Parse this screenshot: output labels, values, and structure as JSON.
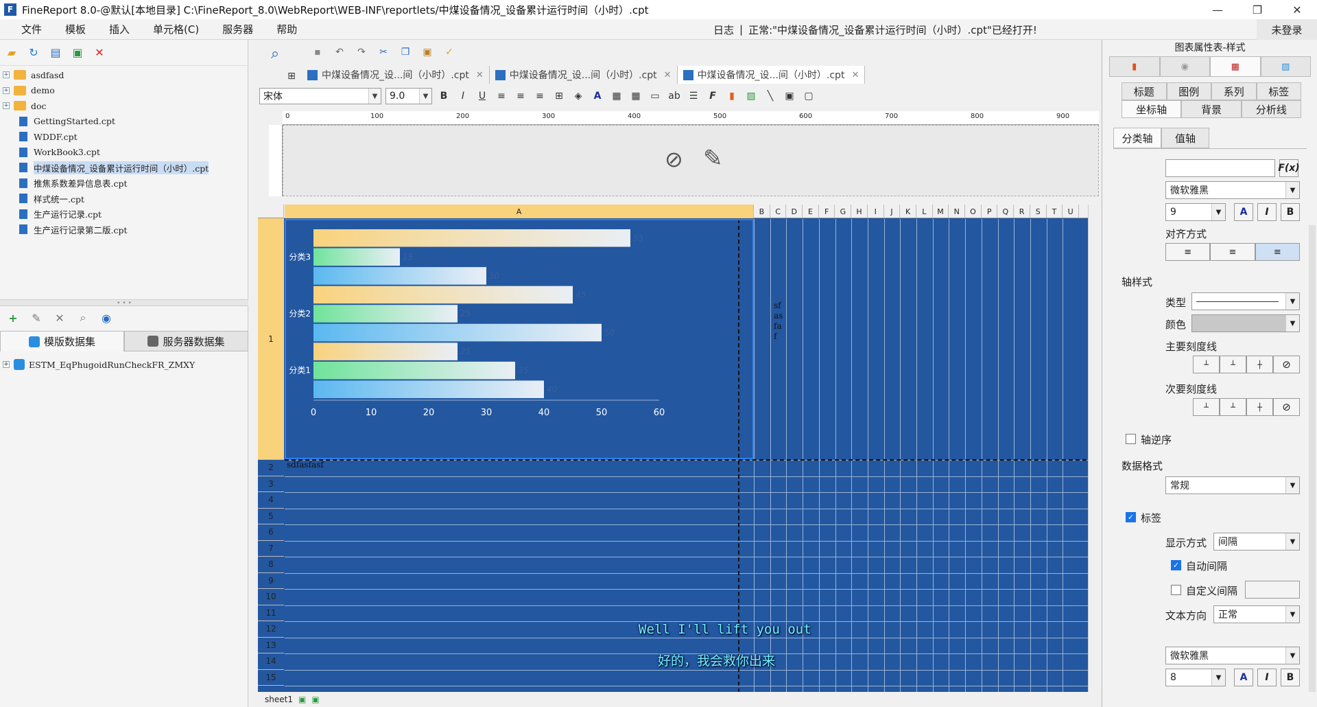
{
  "window": {
    "title": "FineReport 8.0-@默认[本地目录]   C:\\FineReport_8.0\\WebReport\\WEB-INF\\reportlets/中煤设备情况_设备累计运行时间（小时）.cpt",
    "minimize": "—",
    "maximize": "❐",
    "close": "✕"
  },
  "menu": [
    "文件",
    "模板",
    "插入",
    "单元格(C)",
    "服务器",
    "帮助"
  ],
  "log": {
    "label": "日志",
    "message": "正常:\"中煤设备情况_设备累计运行时间（小时）.cpt\"已经打开!"
  },
  "login": "未登录",
  "tree": [
    {
      "label": "asdfasd",
      "type": "folder"
    },
    {
      "label": "demo",
      "type": "folder"
    },
    {
      "label": "doc",
      "type": "folder"
    },
    {
      "label": "GettingStarted.cpt",
      "type": "file"
    },
    {
      "label": "WDDF.cpt",
      "type": "file"
    },
    {
      "label": "WorkBook3.cpt",
      "type": "file"
    },
    {
      "label": "中煤设备情况_设备累计运行时间（小时）.cpt",
      "type": "file",
      "selected": true
    },
    {
      "label": "推焦系数差异信息表.cpt",
      "type": "file"
    },
    {
      "label": "样式统一.cpt",
      "type": "file"
    },
    {
      "label": "生产运行记录.cpt",
      "type": "file"
    },
    {
      "label": "生产运行记录第二版.cpt",
      "type": "file"
    }
  ],
  "datasets": {
    "tab_template": "模版数据集",
    "tab_server": "服务器数据集",
    "item": "ESTM_EqPhugoidRunCheckFR_ZMXY"
  },
  "tabs": [
    {
      "label": "中煤设备情况_设...间（小时）.cpt"
    },
    {
      "label": "中煤设备情况_设...间（小时）.cpt"
    },
    {
      "label": "中煤设备情况_设...间（小时）.cpt",
      "active": true
    }
  ],
  "format": {
    "font": "宋体",
    "size": "9.0"
  },
  "ruler": [
    "0",
    "100",
    "200",
    "300",
    "400",
    "500",
    "600",
    "700",
    "800",
    "900"
  ],
  "columns": [
    "A",
    "B",
    "C",
    "D",
    "E",
    "F",
    "G",
    "H",
    "I",
    "J",
    "K",
    "L",
    "M",
    "N",
    "O",
    "P",
    "Q",
    "R",
    "S",
    "T",
    "U"
  ],
  "rows": [
    "1",
    "2",
    "3",
    "4",
    "5",
    "6",
    "7",
    "8",
    "9",
    "10",
    "11",
    "12",
    "13",
    "14",
    "15"
  ],
  "cells": {
    "a2": "sdfasfasf",
    "b1": "sf as fa f"
  },
  "chart_data": {
    "type": "bar",
    "orientation": "horizontal",
    "categories": [
      "分类1",
      "分类2",
      "分类3"
    ],
    "series": [
      {
        "values": [
          40,
          50,
          30
        ],
        "color": "#5ab8f0"
      },
      {
        "values": [
          35,
          25,
          15
        ],
        "color": "#6fe39a"
      },
      {
        "values": [
          25,
          45,
          55
        ],
        "color": "#f9d27c"
      }
    ],
    "xlim": [
      0,
      60
    ],
    "xticks": [
      "0",
      "10",
      "20",
      "30",
      "40",
      "50",
      "60"
    ],
    "background": "#2357a0"
  },
  "sheet": "sheet1",
  "subtitles": {
    "en": "Well I'll lift you out",
    "zh": "好的，我会救你出来"
  },
  "right": {
    "title": "图表属性表-样式",
    "tabs1": [
      "标题",
      "图例",
      "系列",
      "标签"
    ],
    "tabs2": [
      "坐标轴",
      "背景",
      "分析线"
    ],
    "axis_tabs": [
      "分类轴",
      "值轴"
    ],
    "fx": "F(x)",
    "font1": "微软雅黑",
    "size1": "9",
    "align_label": "对齐方式",
    "axis_style": "轴样式",
    "type_label": "类型",
    "color_label": "颜色",
    "major_tick": "主要刻度线",
    "minor_tick": "次要刻度线",
    "reverse": "轴逆序",
    "data_format": "数据格式",
    "data_format_value": "常规",
    "label_cb": "标签",
    "display_mode": "显示方式",
    "display_mode_value": "间隔",
    "auto_interval": "自动间隔",
    "custom_interval": "自定义间隔",
    "text_dir": "文本方向",
    "text_dir_value": "正常",
    "font2": "微软雅黑",
    "size2": "8"
  }
}
